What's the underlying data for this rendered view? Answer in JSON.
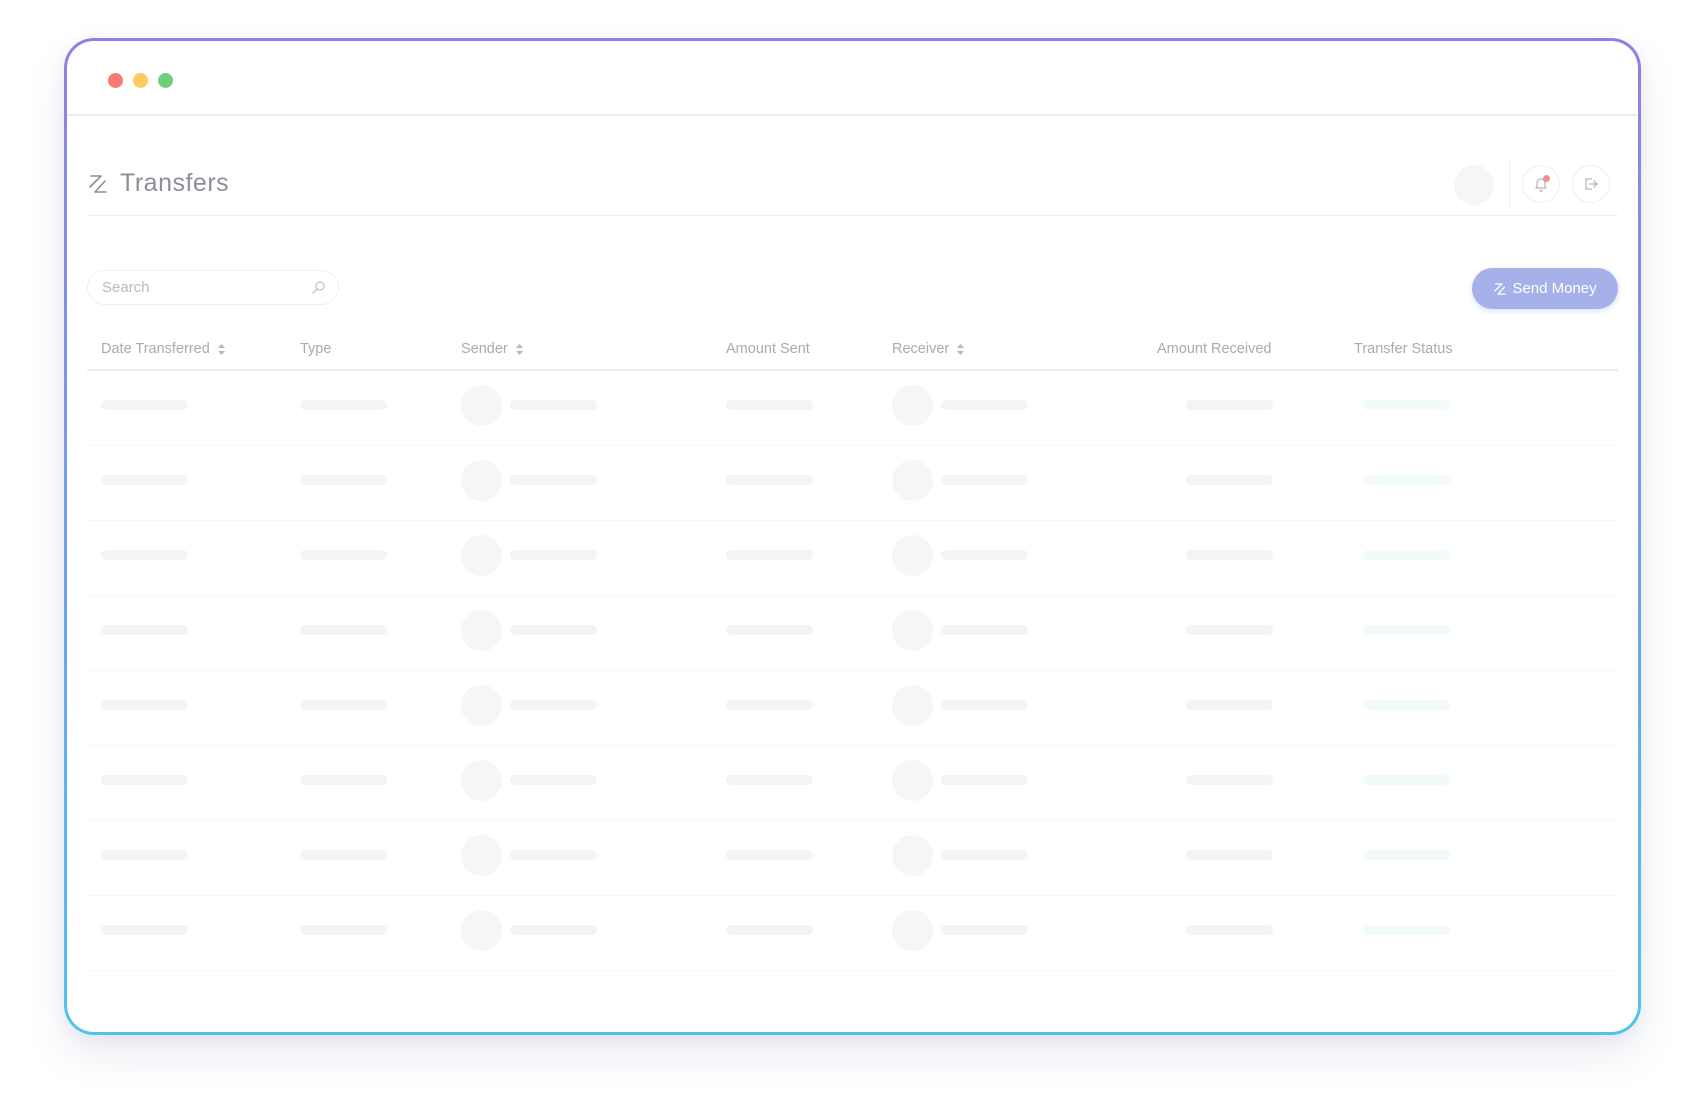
{
  "window": {
    "controls": [
      "close",
      "minimize",
      "maximize"
    ],
    "colors": {
      "close": "#f87a76",
      "minimize": "#fbcb63",
      "maximize": "#6fd07c"
    }
  },
  "header": {
    "title": "Transfers",
    "icon": "transfer-icon",
    "actions": [
      "notification-bell-icon",
      "logout-icon"
    ]
  },
  "search": {
    "placeholder": "Search",
    "value": "",
    "icon": "search-icon"
  },
  "send_button": {
    "label": "Send Money",
    "icon": "transfer-icon",
    "color": "#a6b1ea"
  },
  "table": {
    "columns": [
      {
        "label": "Date Transferred",
        "sortable": true
      },
      {
        "label": "Type",
        "sortable": false
      },
      {
        "label": "Sender",
        "sortable": true
      },
      {
        "label": "Amount Sent",
        "sortable": false
      },
      {
        "label": "Receiver",
        "sortable": true
      },
      {
        "label": "Amount Received",
        "sortable": false
      },
      {
        "label": "Transfer Status",
        "sortable": false
      }
    ],
    "row_count": 8,
    "state": "loading"
  },
  "accent_gradient": [
    "#8f7fe6",
    "#4fc3ee"
  ]
}
